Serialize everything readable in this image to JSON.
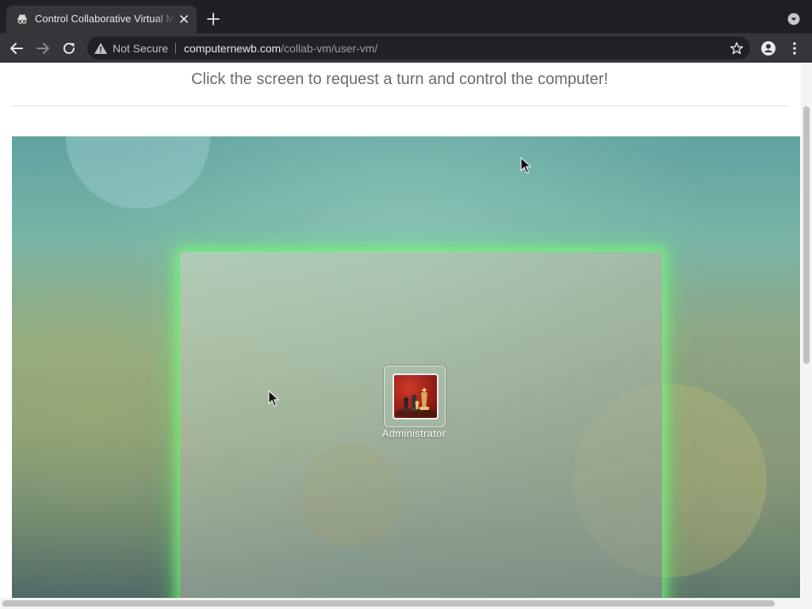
{
  "browser": {
    "tab": {
      "title": "Control Collaborative Virtual Machines",
      "favicon": "spy-icon"
    },
    "new_tab_icon": "plus-icon",
    "tab_menu_icon": "chevron-down-circle-icon",
    "toolbar": {
      "back_icon": "arrow-left-icon",
      "forward_icon": "arrow-right-icon",
      "reload_icon": "reload-icon",
      "security_icon": "warning-triangle-icon",
      "security_label": "Not Secure",
      "url_host": "computernewb.com",
      "url_path": "/collab-vm/user-vm/",
      "bookmark_icon": "star-outline-icon",
      "profile_icon": "person-icon",
      "menu_icon": "kebab-menu-icon"
    }
  },
  "page": {
    "instructions": "Click the screen to request a turn and control the computer!",
    "vm": {
      "user_account": {
        "name": "Administrator",
        "avatar_icon": "chess-pieces-avatar"
      }
    }
  },
  "colors": {
    "tabbar_bg": "#1f2023",
    "toolbar_bg": "#35363a",
    "omnibox_bg": "#202124",
    "logon_glow": "#78ff78"
  }
}
